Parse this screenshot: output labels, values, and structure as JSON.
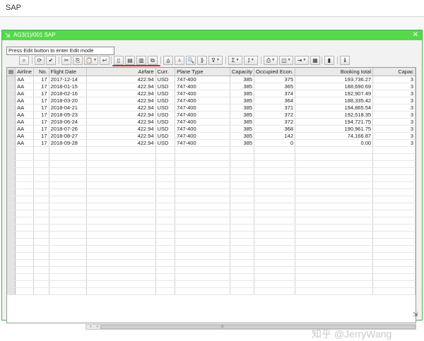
{
  "app": {
    "title": "SAP"
  },
  "dialog": {
    "icon": "⇲",
    "title": "AG3(1)/001 SAP",
    "close_glyph": "✕"
  },
  "status": {
    "message": "Press Edit button to enter Edit mode"
  },
  "toolbar": {
    "buttons": [
      {
        "name": "details-icon",
        "glyph": "⌕"
      },
      {
        "name": "refresh-icon",
        "glyph": "⟳"
      },
      {
        "name": "check-icon",
        "glyph": "✔"
      },
      {
        "name": "undo-icon",
        "glyph": "↶"
      },
      {
        "name": "cut-icon",
        "glyph": "✂"
      },
      {
        "name": "copy-icon",
        "glyph": "⎘"
      },
      {
        "name": "paste-icon",
        "glyph": "📋"
      },
      {
        "name": "undo-arrow-icon",
        "glyph": "↩"
      },
      {
        "name": "new-row-icon",
        "glyph": "▯"
      },
      {
        "name": "insert-row-icon",
        "glyph": "▤"
      },
      {
        "name": "delete-row-icon",
        "glyph": "▥"
      },
      {
        "name": "copy-row-icon",
        "glyph": "⧉"
      },
      {
        "name": "sort-asc-icon",
        "glyph": "⩠"
      },
      {
        "name": "sort-desc-icon",
        "glyph": "⩡"
      },
      {
        "name": "find-icon",
        "glyph": "🔍"
      },
      {
        "name": "find-next-icon",
        "glyph": "⟫"
      },
      {
        "name": "filter-icon",
        "glyph": "⊽"
      },
      {
        "name": "sum-icon",
        "glyph": "Σ"
      },
      {
        "name": "subtotal-icon",
        "glyph": "⁒"
      },
      {
        "name": "print-icon",
        "glyph": "⎙"
      },
      {
        "name": "view-icon",
        "glyph": "◫"
      },
      {
        "name": "export-icon",
        "glyph": "⇥"
      },
      {
        "name": "layout-icon",
        "glyph": "▦"
      },
      {
        "name": "graphic-icon",
        "glyph": "▮"
      },
      {
        "name": "info-icon",
        "glyph": "ℹ"
      }
    ]
  },
  "table": {
    "columns": [
      "Airline",
      "No.",
      "Flight Date",
      "Airfare",
      "Curr.",
      "Plane Type",
      "Capacity",
      "Occupied Econ.",
      "Booking total",
      "Capac"
    ],
    "rows": [
      {
        "airline": "AA",
        "no": "17",
        "date": "2017-12-14",
        "airfare": "422.94",
        "curr": "USD",
        "plane": "747-400",
        "capacity": "385",
        "occupied": "375",
        "booking": "193,736.27",
        "capac2": "3"
      },
      {
        "airline": "AA",
        "no": "17",
        "date": "2018-01-15",
        "airfare": "422.94",
        "curr": "USD",
        "plane": "747-400",
        "capacity": "385",
        "occupied": "365",
        "booking": "188,690.69",
        "capac2": "3"
      },
      {
        "airline": "AA",
        "no": "17",
        "date": "2018-02-16",
        "airfare": "422.94",
        "curr": "USD",
        "plane": "747-400",
        "capacity": "385",
        "occupied": "374",
        "booking": "192,907.49",
        "capac2": "3"
      },
      {
        "airline": "AA",
        "no": "17",
        "date": "2018-03-20",
        "airfare": "422.94",
        "curr": "USD",
        "plane": "747-400",
        "capacity": "385",
        "occupied": "364",
        "booking": "188,335.42",
        "capac2": "3"
      },
      {
        "airline": "AA",
        "no": "17",
        "date": "2018-04-21",
        "airfare": "422.94",
        "curr": "USD",
        "plane": "747-400",
        "capacity": "385",
        "occupied": "371",
        "booking": "194,865.54",
        "capac2": "3"
      },
      {
        "airline": "AA",
        "no": "17",
        "date": "2018-05-23",
        "airfare": "422.94",
        "curr": "USD",
        "plane": "747-400",
        "capacity": "385",
        "occupied": "372",
        "booking": "192,518.35",
        "capac2": "3"
      },
      {
        "airline": "AA",
        "no": "17",
        "date": "2018-06-24",
        "airfare": "422.94",
        "curr": "USD",
        "plane": "747-400",
        "capacity": "385",
        "occupied": "372",
        "booking": "194,721.75",
        "capac2": "3"
      },
      {
        "airline": "AA",
        "no": "17",
        "date": "2018-07-26",
        "airfare": "422.94",
        "curr": "USD",
        "plane": "747-400",
        "capacity": "385",
        "occupied": "368",
        "booking": "190,961.75",
        "capac2": "3"
      },
      {
        "airline": "AA",
        "no": "17",
        "date": "2018-08-27",
        "airfare": "422.94",
        "curr": "USD",
        "plane": "747-400",
        "capacity": "385",
        "occupied": "142",
        "booking": "74,166.87",
        "capac2": "3"
      },
      {
        "airline": "AA",
        "no": "17",
        "date": "2018-09-28",
        "airfare": "422.94",
        "curr": "USD",
        "plane": "747-400",
        "capacity": "385",
        "occupied": "0",
        "booking": "0.00",
        "capac2": "3"
      }
    ]
  },
  "scrollbar": {
    "left_glyph": "‹",
    "right_glyph": "›",
    "grip_glyph": "≡"
  },
  "watermark": {
    "text": "知乎 @JerryWang"
  },
  "corner": {
    "glyph": "⇲"
  }
}
